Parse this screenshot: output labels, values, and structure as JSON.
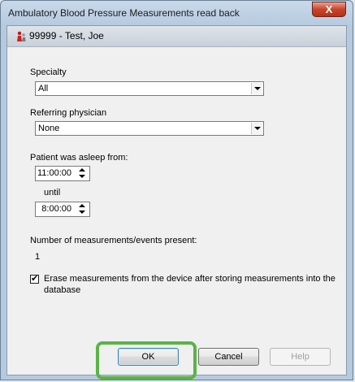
{
  "window": {
    "title": "Ambulatory Blood Pressure Measurements read back",
    "close_label": "X"
  },
  "patient": {
    "name": "99999 - Test, Joe"
  },
  "specialty": {
    "label": "Specialty",
    "value": "All"
  },
  "referring": {
    "label": "Referring physician",
    "value": "None"
  },
  "sleep": {
    "label": "Patient was asleep from:",
    "from": "11:00:00",
    "until_label": "until",
    "until": "8:00:00"
  },
  "measurements": {
    "label": "Number of measurements/events present:",
    "count": "1"
  },
  "erase": {
    "checked": true,
    "label_line1": "Erase measurements from the device after storing measurements into the",
    "label_line2": "database"
  },
  "buttons": {
    "ok": "OK",
    "cancel": "Cancel",
    "help": "Help"
  },
  "colors": {
    "highlight": "#5ab446"
  }
}
